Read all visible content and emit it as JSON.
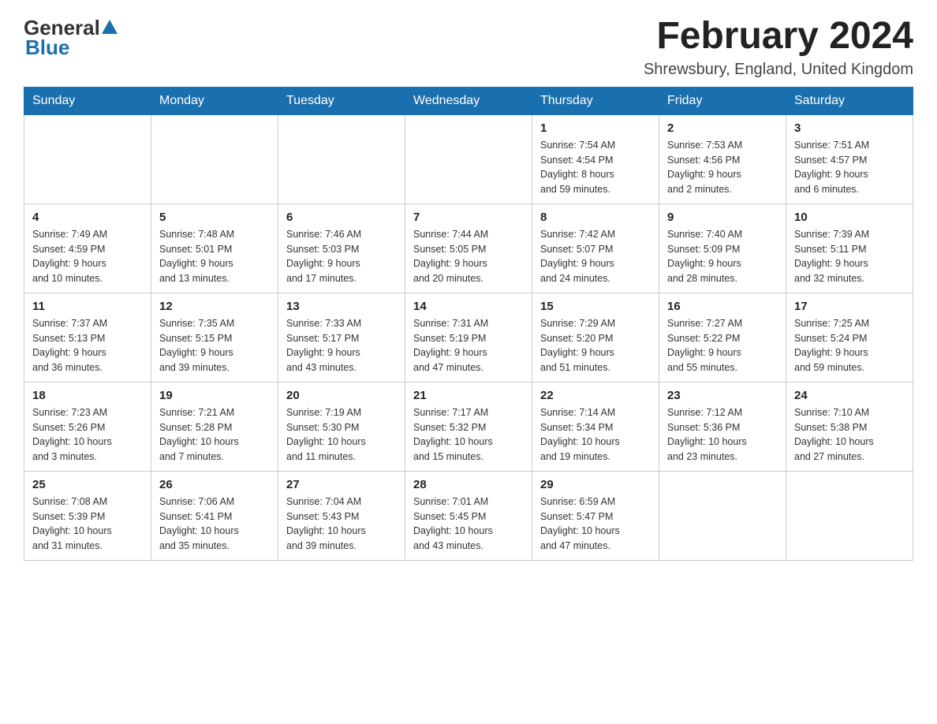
{
  "logo": {
    "general": "General",
    "blue": "Blue"
  },
  "header": {
    "title": "February 2024",
    "location": "Shrewsbury, England, United Kingdom"
  },
  "days_of_week": [
    "Sunday",
    "Monday",
    "Tuesday",
    "Wednesday",
    "Thursday",
    "Friday",
    "Saturday"
  ],
  "weeks": [
    {
      "cells": [
        {
          "day": "",
          "info": ""
        },
        {
          "day": "",
          "info": ""
        },
        {
          "day": "",
          "info": ""
        },
        {
          "day": "",
          "info": ""
        },
        {
          "day": "1",
          "info": "Sunrise: 7:54 AM\nSunset: 4:54 PM\nDaylight: 8 hours\nand 59 minutes."
        },
        {
          "day": "2",
          "info": "Sunrise: 7:53 AM\nSunset: 4:56 PM\nDaylight: 9 hours\nand 2 minutes."
        },
        {
          "day": "3",
          "info": "Sunrise: 7:51 AM\nSunset: 4:57 PM\nDaylight: 9 hours\nand 6 minutes."
        }
      ]
    },
    {
      "cells": [
        {
          "day": "4",
          "info": "Sunrise: 7:49 AM\nSunset: 4:59 PM\nDaylight: 9 hours\nand 10 minutes."
        },
        {
          "day": "5",
          "info": "Sunrise: 7:48 AM\nSunset: 5:01 PM\nDaylight: 9 hours\nand 13 minutes."
        },
        {
          "day": "6",
          "info": "Sunrise: 7:46 AM\nSunset: 5:03 PM\nDaylight: 9 hours\nand 17 minutes."
        },
        {
          "day": "7",
          "info": "Sunrise: 7:44 AM\nSunset: 5:05 PM\nDaylight: 9 hours\nand 20 minutes."
        },
        {
          "day": "8",
          "info": "Sunrise: 7:42 AM\nSunset: 5:07 PM\nDaylight: 9 hours\nand 24 minutes."
        },
        {
          "day": "9",
          "info": "Sunrise: 7:40 AM\nSunset: 5:09 PM\nDaylight: 9 hours\nand 28 minutes."
        },
        {
          "day": "10",
          "info": "Sunrise: 7:39 AM\nSunset: 5:11 PM\nDaylight: 9 hours\nand 32 minutes."
        }
      ]
    },
    {
      "cells": [
        {
          "day": "11",
          "info": "Sunrise: 7:37 AM\nSunset: 5:13 PM\nDaylight: 9 hours\nand 36 minutes."
        },
        {
          "day": "12",
          "info": "Sunrise: 7:35 AM\nSunset: 5:15 PM\nDaylight: 9 hours\nand 39 minutes."
        },
        {
          "day": "13",
          "info": "Sunrise: 7:33 AM\nSunset: 5:17 PM\nDaylight: 9 hours\nand 43 minutes."
        },
        {
          "day": "14",
          "info": "Sunrise: 7:31 AM\nSunset: 5:19 PM\nDaylight: 9 hours\nand 47 minutes."
        },
        {
          "day": "15",
          "info": "Sunrise: 7:29 AM\nSunset: 5:20 PM\nDaylight: 9 hours\nand 51 minutes."
        },
        {
          "day": "16",
          "info": "Sunrise: 7:27 AM\nSunset: 5:22 PM\nDaylight: 9 hours\nand 55 minutes."
        },
        {
          "day": "17",
          "info": "Sunrise: 7:25 AM\nSunset: 5:24 PM\nDaylight: 9 hours\nand 59 minutes."
        }
      ]
    },
    {
      "cells": [
        {
          "day": "18",
          "info": "Sunrise: 7:23 AM\nSunset: 5:26 PM\nDaylight: 10 hours\nand 3 minutes."
        },
        {
          "day": "19",
          "info": "Sunrise: 7:21 AM\nSunset: 5:28 PM\nDaylight: 10 hours\nand 7 minutes."
        },
        {
          "day": "20",
          "info": "Sunrise: 7:19 AM\nSunset: 5:30 PM\nDaylight: 10 hours\nand 11 minutes."
        },
        {
          "day": "21",
          "info": "Sunrise: 7:17 AM\nSunset: 5:32 PM\nDaylight: 10 hours\nand 15 minutes."
        },
        {
          "day": "22",
          "info": "Sunrise: 7:14 AM\nSunset: 5:34 PM\nDaylight: 10 hours\nand 19 minutes."
        },
        {
          "day": "23",
          "info": "Sunrise: 7:12 AM\nSunset: 5:36 PM\nDaylight: 10 hours\nand 23 minutes."
        },
        {
          "day": "24",
          "info": "Sunrise: 7:10 AM\nSunset: 5:38 PM\nDaylight: 10 hours\nand 27 minutes."
        }
      ]
    },
    {
      "cells": [
        {
          "day": "25",
          "info": "Sunrise: 7:08 AM\nSunset: 5:39 PM\nDaylight: 10 hours\nand 31 minutes."
        },
        {
          "day": "26",
          "info": "Sunrise: 7:06 AM\nSunset: 5:41 PM\nDaylight: 10 hours\nand 35 minutes."
        },
        {
          "day": "27",
          "info": "Sunrise: 7:04 AM\nSunset: 5:43 PM\nDaylight: 10 hours\nand 39 minutes."
        },
        {
          "day": "28",
          "info": "Sunrise: 7:01 AM\nSunset: 5:45 PM\nDaylight: 10 hours\nand 43 minutes."
        },
        {
          "day": "29",
          "info": "Sunrise: 6:59 AM\nSunset: 5:47 PM\nDaylight: 10 hours\nand 47 minutes."
        },
        {
          "day": "",
          "info": ""
        },
        {
          "day": "",
          "info": ""
        }
      ]
    }
  ]
}
